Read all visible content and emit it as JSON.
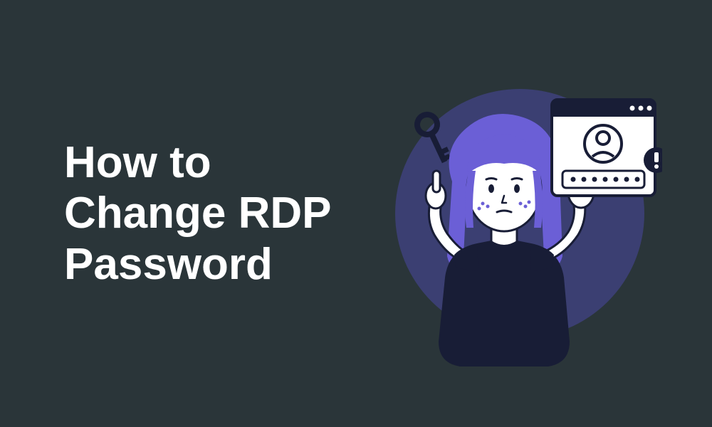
{
  "title": "How to Change RDP Password",
  "colors": {
    "background": "#2a3539",
    "text": "#ffffff",
    "accent_purple": "#6b5fd6",
    "dark_navy": "#181d36",
    "circle_bg": "#3b3f72"
  },
  "illustration": {
    "description": "Woman with purple hair pointing up, holding login window with avatar and password dots, key icon, alert badge"
  }
}
